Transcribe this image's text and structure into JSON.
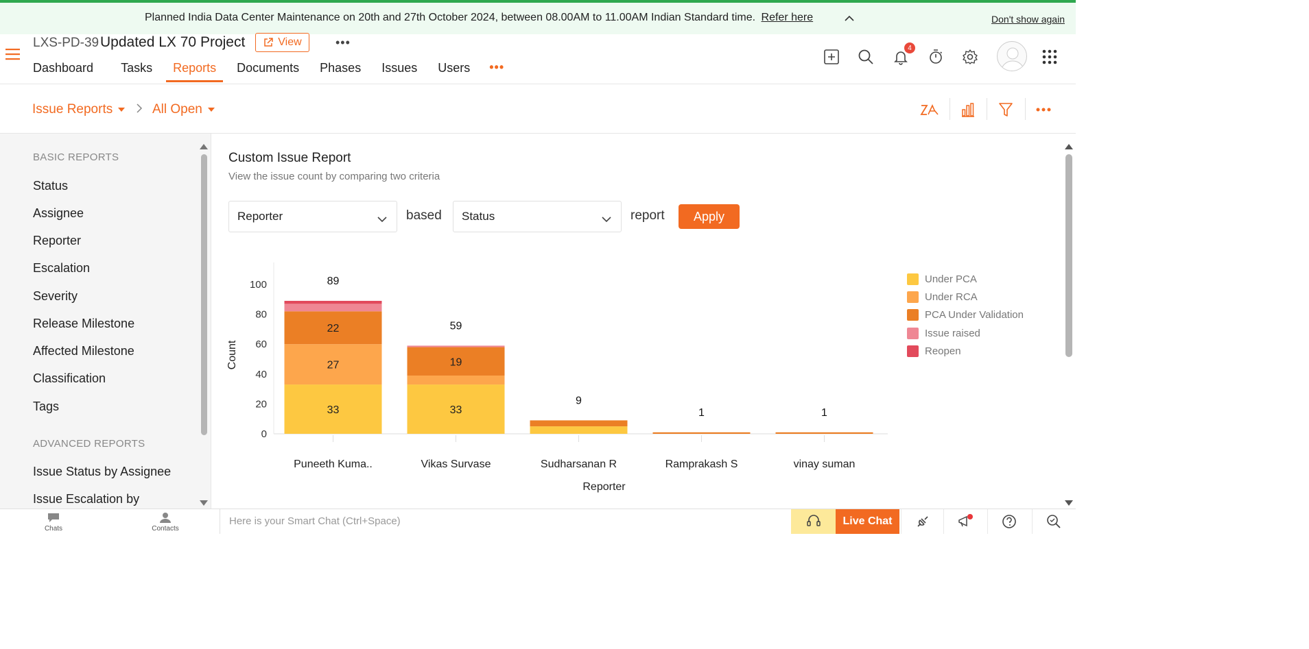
{
  "banner": {
    "text": "Planned India Data Center Maintenance on 20th and 27th October 2024, between 08.00AM to 11.00AM Indian Standard time.",
    "link": "Refer here",
    "dismiss": "Don't show again"
  },
  "project": {
    "id": "LXS-PD-39",
    "name": "Updated LX 70 Project",
    "view_label": "View",
    "more": "•••"
  },
  "tabs": [
    {
      "label": "Dashboard"
    },
    {
      "label": "Tasks"
    },
    {
      "label": "Reports"
    },
    {
      "label": "Documents"
    },
    {
      "label": "Phases"
    },
    {
      "label": "Issues"
    },
    {
      "label": "Users"
    }
  ],
  "tabs_more": "•••",
  "notifications_count": "4",
  "breadcrumb": {
    "root": "Issue Reports",
    "current": "All Open"
  },
  "sidebar": {
    "basic_title": "BASIC REPORTS",
    "basic_items": [
      {
        "label": "Status"
      },
      {
        "label": "Assignee"
      },
      {
        "label": "Reporter"
      },
      {
        "label": "Escalation"
      },
      {
        "label": "Severity"
      },
      {
        "label": "Release Milestone"
      },
      {
        "label": "Affected Milestone"
      },
      {
        "label": "Classification"
      },
      {
        "label": "Tags"
      }
    ],
    "advanced_title": "ADVANCED REPORTS",
    "advanced_items": [
      {
        "label": "Issue Status by Assignee"
      },
      {
        "label": "Issue Escalation by"
      }
    ]
  },
  "report": {
    "title": "Custom Issue Report",
    "subtitle": "View the issue count by comparing two criteria",
    "select1": "Reporter",
    "word_based": "based",
    "select2": "Status",
    "word_report": "report",
    "apply_label": "Apply"
  },
  "colors": {
    "accent": "#f26a21"
  },
  "chart_data": {
    "type": "bar",
    "stacked": true,
    "xlabel": "Reporter",
    "ylabel": "Count",
    "ylim": [
      0,
      110
    ],
    "yticks": [
      0,
      20,
      40,
      60,
      80,
      100
    ],
    "categories": [
      "Puneeth Kuma..",
      "Vikas Survase",
      "Sudharsanan R",
      "Ramprakash S",
      "vinay suman"
    ],
    "totals": [
      89,
      59,
      9,
      1,
      1
    ],
    "legend_position": "right",
    "series": [
      {
        "name": "Under PCA",
        "color": "#fdc841",
        "values": [
          33,
          33,
          5,
          0,
          0
        ],
        "labels": [
          "33",
          "33",
          "",
          "",
          ""
        ]
      },
      {
        "name": "Under RCA",
        "color": "#fda64c",
        "values": [
          27,
          6,
          0,
          0,
          0
        ],
        "labels": [
          "27",
          "",
          "",
          "",
          ""
        ]
      },
      {
        "name": "PCA Under Validation",
        "color": "#eb7f25",
        "values": [
          22,
          19,
          4,
          1,
          1
        ],
        "labels": [
          "22",
          "19",
          "",
          "",
          ""
        ]
      },
      {
        "name": "Issue raised",
        "color": "#ef8794",
        "values": [
          5,
          1,
          0,
          0,
          0
        ],
        "labels": [
          "",
          "",
          "",
          "",
          ""
        ]
      },
      {
        "name": "Reopen",
        "color": "#e24a5c",
        "values": [
          2,
          0,
          0,
          0,
          0
        ],
        "labels": [
          "",
          "",
          "",
          "",
          ""
        ]
      }
    ]
  },
  "bottombar": {
    "chats": "Chats",
    "contacts": "Contacts",
    "smart_chat_placeholder": "Here is your Smart Chat (Ctrl+Space)",
    "live_chat": "Live Chat"
  }
}
